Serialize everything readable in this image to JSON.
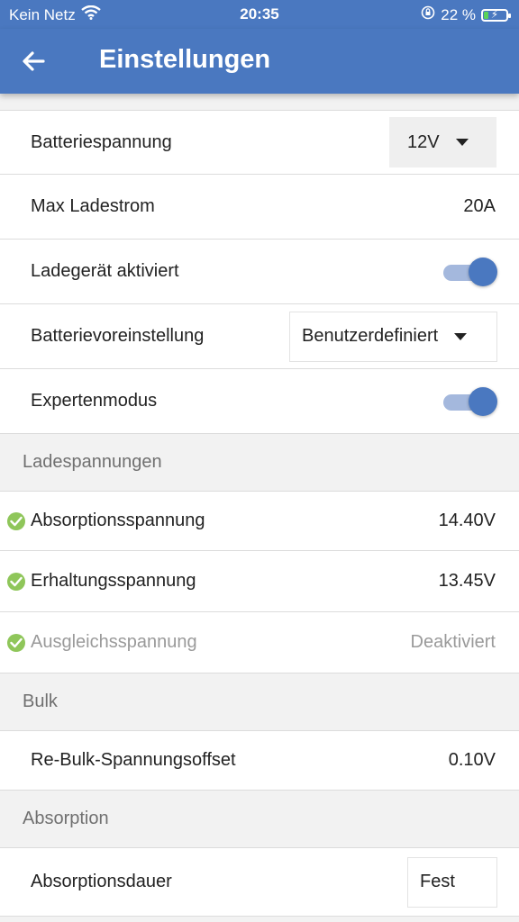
{
  "status_bar": {
    "carrier": "Kein Netz",
    "time": "20:35",
    "battery_percent": "22 %",
    "battery_level": 0.22,
    "wifi_icon": "wifi-icon",
    "rotation_lock_icon": "rotation-lock-icon",
    "battery_icon": "battery-charging-icon"
  },
  "app_bar": {
    "title": "Einstellungen",
    "back_icon": "arrow-left-icon",
    "color": "#4a78c0"
  },
  "settings": {
    "battery_voltage": {
      "label": "Batteriespannung",
      "value": "12V"
    },
    "max_charge_current": {
      "label": "Max Ladestrom",
      "value": "20A"
    },
    "charger_enabled": {
      "label": "Ladegerät aktiviert",
      "on": true
    },
    "battery_preset": {
      "label": "Batterievoreinstellung",
      "value": "Benutzerdefiniert"
    },
    "expert_mode": {
      "label": "Expertenmodus",
      "on": true
    }
  },
  "sections": {
    "charge_voltages": {
      "title": "Ladespannungen",
      "items": [
        {
          "label": "Absorptionsspannung",
          "value": "14.40V",
          "status": "check"
        },
        {
          "label": "Erhaltungsspannung",
          "value": "13.45V",
          "status": "check"
        },
        {
          "label": "Ausgleichsspannung",
          "value": "Deaktiviert",
          "status": "check",
          "disabled": true
        }
      ]
    },
    "bulk": {
      "title": "Bulk",
      "items": [
        {
          "label": "Re-Bulk-Spannungsoffset",
          "value": "0.10V"
        }
      ]
    },
    "absorption": {
      "title": "Absorption",
      "items": [
        {
          "label": "Absorptionsdauer",
          "value": "Fest"
        }
      ]
    }
  },
  "colors": {
    "accent": "#4a78c0",
    "check": "#8fc65a",
    "muted_text": "#9a9a9a"
  }
}
